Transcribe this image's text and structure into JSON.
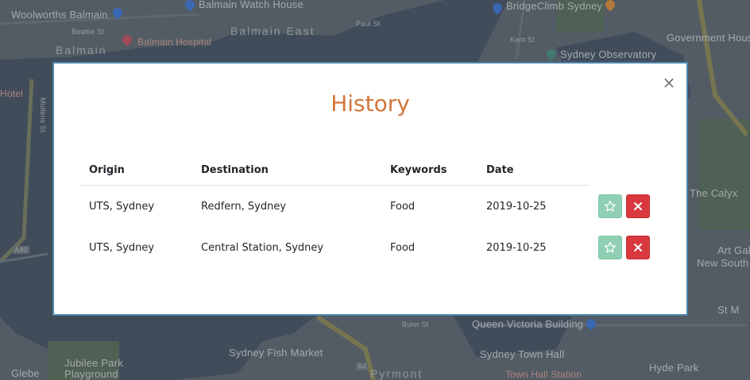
{
  "map": {
    "labels": {
      "woolworths": "Woolworths Balmain",
      "balmain_watch_house": "Balmain Watch House",
      "balmain_east": "Balmain East",
      "balmain": "Balmain",
      "balmain_hospital": "Balmain Hospital",
      "bridgeclimb": "BridgeClimb Sydney",
      "government_house": "Government House",
      "sydney_observatory": "Sydney Observatory",
      "hotel": "Hotel",
      "the_calyx": "The Calyx",
      "art_gallery": "Art Gall",
      "new_south": "New South",
      "st_m": "St M",
      "queen_victoria": "Queen Victoria Building",
      "sydney_fish_market": "Sydney Fish Market",
      "sydney_town_hall": "Sydney Town Hall",
      "town_hall_station": "Town Hall Station",
      "hyde_park": "Hyde Park",
      "jubilee_park": "Jubilee Park",
      "playground": "Playground",
      "glebe": "Glebe",
      "pyrmont": "Pyrmont",
      "paul_st": "Paul St",
      "beattie_st": "Beattie St",
      "mullens_st": "Mullens St",
      "bunn_st": "Bunn St",
      "kent_st": "Kent St",
      "a40": "A40",
      "a4": "A4"
    }
  },
  "modal": {
    "title": "History",
    "close_label": "×",
    "columns": [
      "Origin",
      "Destination",
      "Keywords",
      "Date"
    ],
    "rows": [
      {
        "origin": "UTS, Sydney",
        "destination": "Redfern, Sydney",
        "keywords": "Food",
        "date": "2019-10-25"
      },
      {
        "origin": "UTS, Sydney",
        "destination": "Central Station, Sydney",
        "keywords": "Food",
        "date": "2019-10-25"
      }
    ],
    "favorite_icon": "star-icon",
    "delete_icon": "close-icon"
  },
  "colors": {
    "title": "#d1763a",
    "favorite": "#8fd0b4",
    "delete": "#d9393e",
    "modal_border": "#4a86a8"
  }
}
